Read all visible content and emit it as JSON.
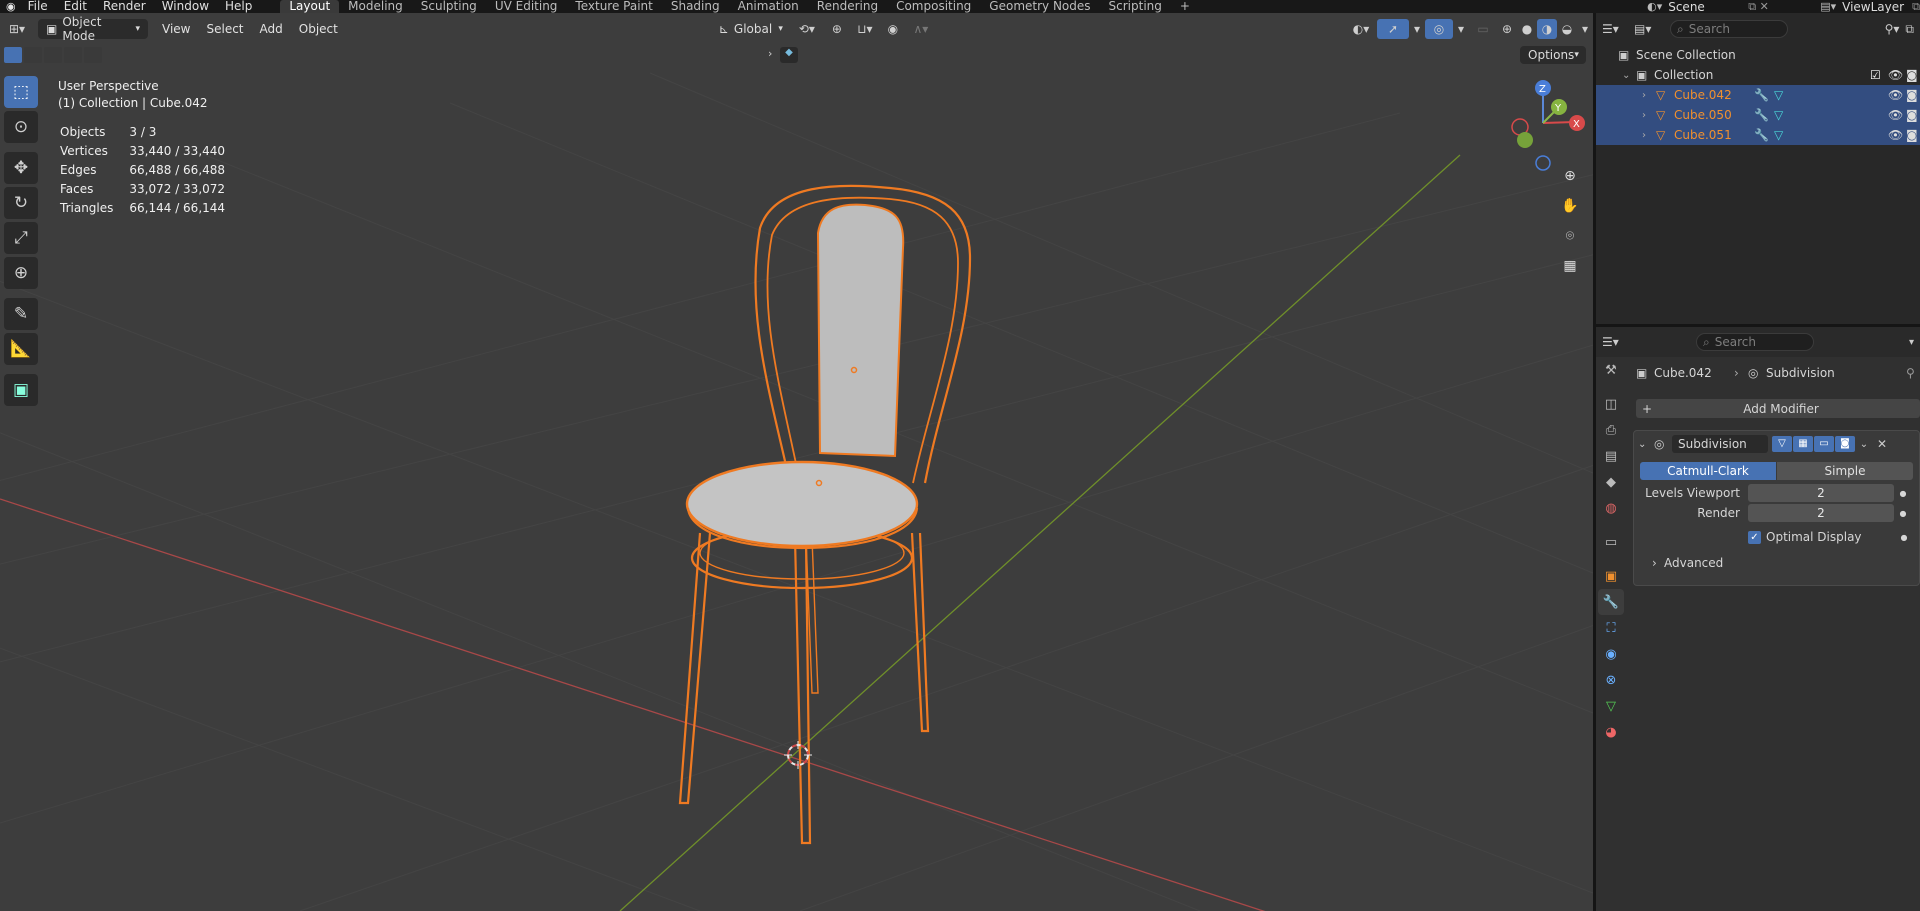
{
  "topbar": {
    "menus": [
      "File",
      "Edit",
      "Render",
      "Window",
      "Help"
    ],
    "workspaces": [
      "Layout",
      "Modeling",
      "Sculpting",
      "UV Editing",
      "Texture Paint",
      "Shading",
      "Animation",
      "Rendering",
      "Compositing",
      "Geometry Nodes",
      "Scripting"
    ],
    "active_workspace": "Layout",
    "scene": "Scene",
    "view_layer": "ViewLayer"
  },
  "viewport_header": {
    "mode": "Object Mode",
    "menus": [
      "View",
      "Select",
      "Add",
      "Object"
    ],
    "orientation": "Global",
    "options_label": "Options"
  },
  "overlay": {
    "perspective": "User Perspective",
    "collection_line": "(1) Collection | Cube.042",
    "stats": [
      {
        "label": "Objects",
        "value": "3 / 3"
      },
      {
        "label": "Vertices",
        "value": "33,440 / 33,440"
      },
      {
        "label": "Edges",
        "value": "66,488 / 66,488"
      },
      {
        "label": "Faces",
        "value": "33,072 / 33,072"
      },
      {
        "label": "Triangles",
        "value": "66,144 / 66,144"
      }
    ]
  },
  "gizmo": {
    "z": "Z",
    "y": "Y",
    "x": "X"
  },
  "outliner": {
    "search_placeholder": "Search",
    "scene_collection": "Scene Collection",
    "collection": "Collection",
    "objects": [
      "Cube.042",
      "Cube.050",
      "Cube.051"
    ]
  },
  "properties": {
    "search_placeholder": "Search",
    "breadcrumb_object": "Cube.042",
    "breadcrumb_modifier": "Subdivision",
    "add_modifier": "Add Modifier",
    "modifier_name": "Subdivision",
    "type_options": [
      "Catmull-Clark",
      "Simple"
    ],
    "selected_type": "Catmull-Clark",
    "levels_viewport_label": "Levels Viewport",
    "levels_viewport": "2",
    "render_label": "Render",
    "render_value": "2",
    "optimal_display_label": "Optimal Display",
    "optimal_display": true,
    "advanced_label": "Advanced"
  },
  "colors": {
    "viewport_bg": "#3d3d3d",
    "selection": "#f0902e",
    "accent": "#4772b3",
    "x_axis": "#c84a4a",
    "y_axis": "#7fa12f"
  }
}
